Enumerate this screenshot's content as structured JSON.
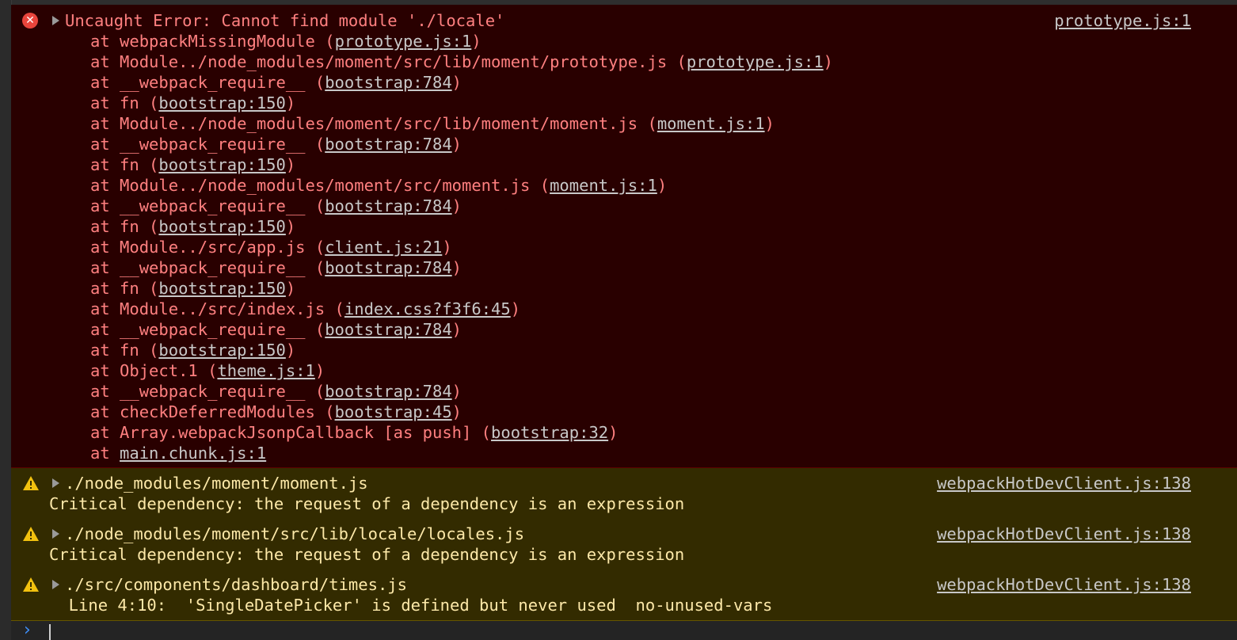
{
  "error": {
    "message": "Uncaught Error: Cannot find module './locale'",
    "source": "prototype.js:1",
    "stack": [
      {
        "pre": "at webpackMissingModule (",
        "link": "prototype.js:1",
        "post": ")"
      },
      {
        "pre": "at Module../node_modules/moment/src/lib/moment/prototype.js (",
        "link": "prototype.js:1",
        "post": ")"
      },
      {
        "pre": "at __webpack_require__ (",
        "link": "bootstrap:784",
        "post": ")"
      },
      {
        "pre": "at fn (",
        "link": "bootstrap:150",
        "post": ")"
      },
      {
        "pre": "at Module../node_modules/moment/src/lib/moment/moment.js (",
        "link": "moment.js:1",
        "post": ")"
      },
      {
        "pre": "at __webpack_require__ (",
        "link": "bootstrap:784",
        "post": ")"
      },
      {
        "pre": "at fn (",
        "link": "bootstrap:150",
        "post": ")"
      },
      {
        "pre": "at Module../node_modules/moment/src/moment.js (",
        "link": "moment.js:1",
        "post": ")"
      },
      {
        "pre": "at __webpack_require__ (",
        "link": "bootstrap:784",
        "post": ")"
      },
      {
        "pre": "at fn (",
        "link": "bootstrap:150",
        "post": ")"
      },
      {
        "pre": "at Module../src/app.js (",
        "link": "client.js:21",
        "post": ")"
      },
      {
        "pre": "at __webpack_require__ (",
        "link": "bootstrap:784",
        "post": ")"
      },
      {
        "pre": "at fn (",
        "link": "bootstrap:150",
        "post": ")"
      },
      {
        "pre": "at Module../src/index.js (",
        "link": "index.css?f3f6:45",
        "post": ")"
      },
      {
        "pre": "at __webpack_require__ (",
        "link": "bootstrap:784",
        "post": ")"
      },
      {
        "pre": "at fn (",
        "link": "bootstrap:150",
        "post": ")"
      },
      {
        "pre": "at Object.1 (",
        "link": "theme.js:1",
        "post": ")"
      },
      {
        "pre": "at __webpack_require__ (",
        "link": "bootstrap:784",
        "post": ")"
      },
      {
        "pre": "at checkDeferredModules (",
        "link": "bootstrap:45",
        "post": ")"
      },
      {
        "pre": "at Array.webpackJsonpCallback [as push] (",
        "link": "bootstrap:32",
        "post": ")"
      },
      {
        "pre": "at ",
        "link": "main.chunk.js:1",
        "post": ""
      }
    ]
  },
  "warnings": [
    {
      "title": "./node_modules/moment/moment.js",
      "detail": "Critical dependency: the request of a dependency is an expression",
      "source": "webpackHotDevClient.js:138"
    },
    {
      "title": "./node_modules/moment/src/lib/locale/locales.js",
      "detail": "Critical dependency: the request of a dependency is an expression",
      "source": "webpackHotDevClient.js:138"
    },
    {
      "title": "./src/components/dashboard/times.js",
      "detail": "  Line 4:10:  'SingleDatePicker' is defined but never used  no-unused-vars",
      "source": "webpackHotDevClient.js:138"
    }
  ],
  "icons": {
    "error": "error-circle-x-icon",
    "warning": "warning-triangle-icon",
    "expand": "expand-triangle-icon",
    "prompt": "prompt-chevron-icon"
  },
  "colors": {
    "error_bg": "#290000",
    "error_text": "#ff8080",
    "warning_bg": "#332b00",
    "warning_text": "#fde9a9",
    "link": "#c8c8c8",
    "prompt": "#3e8ef7"
  }
}
